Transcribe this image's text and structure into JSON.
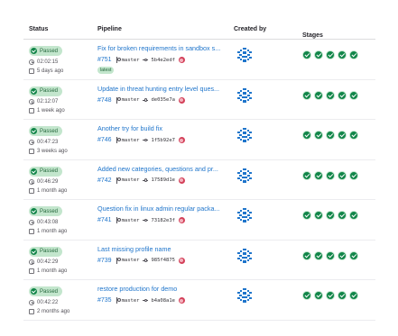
{
  "columns": {
    "status": "Status",
    "pipeline": "Pipeline",
    "created_by": "Created by",
    "stages": "Stages"
  },
  "colors": {
    "passed_bg": "#c3e6cd",
    "passed_fg": "#24663b",
    "success": "#108548",
    "link": "#1f75cb"
  },
  "rows": [
    {
      "status": "Passed",
      "duration": "02:02:15",
      "ago": "5 days ago",
      "title": "Fix for broken requirements in sandbox s...",
      "id": "#751",
      "branch": "master",
      "sha": "5b4e2edf",
      "tag": "latest",
      "stages": 5
    },
    {
      "status": "Passed",
      "duration": "02:12:07",
      "ago": "1 week ago",
      "title": "Update in threat hunting entry level ques...",
      "id": "#748",
      "branch": "master",
      "sha": "de035e7a",
      "stages": 5
    },
    {
      "status": "Passed",
      "duration": "00:47:23",
      "ago": "3 weeks ago",
      "title": "Another try for build fix",
      "id": "#746",
      "branch": "master",
      "sha": "1f5b92e7",
      "stages": 5
    },
    {
      "status": "Passed",
      "duration": "00:46:29",
      "ago": "1 month ago",
      "title": "Added new categories, questions and pr...",
      "id": "#742",
      "branch": "master",
      "sha": "17589d1e",
      "stages": 5
    },
    {
      "status": "Passed",
      "duration": "00:43:08",
      "ago": "1 month ago",
      "title": "Question fix in linux admin regular packa...",
      "id": "#741",
      "branch": "master",
      "sha": "73182e3f",
      "stages": 5
    },
    {
      "status": "Passed",
      "duration": "00:42:29",
      "ago": "1 month ago",
      "title": "Last missing profile name",
      "id": "#739",
      "branch": "master",
      "sha": "985f4875",
      "stages": 5
    },
    {
      "status": "Passed",
      "duration": "00:42:22",
      "ago": "2 months ago",
      "title": "restore production for demo",
      "id": "#735",
      "branch": "master",
      "sha": "b4a08a1e",
      "stages": 5
    }
  ]
}
